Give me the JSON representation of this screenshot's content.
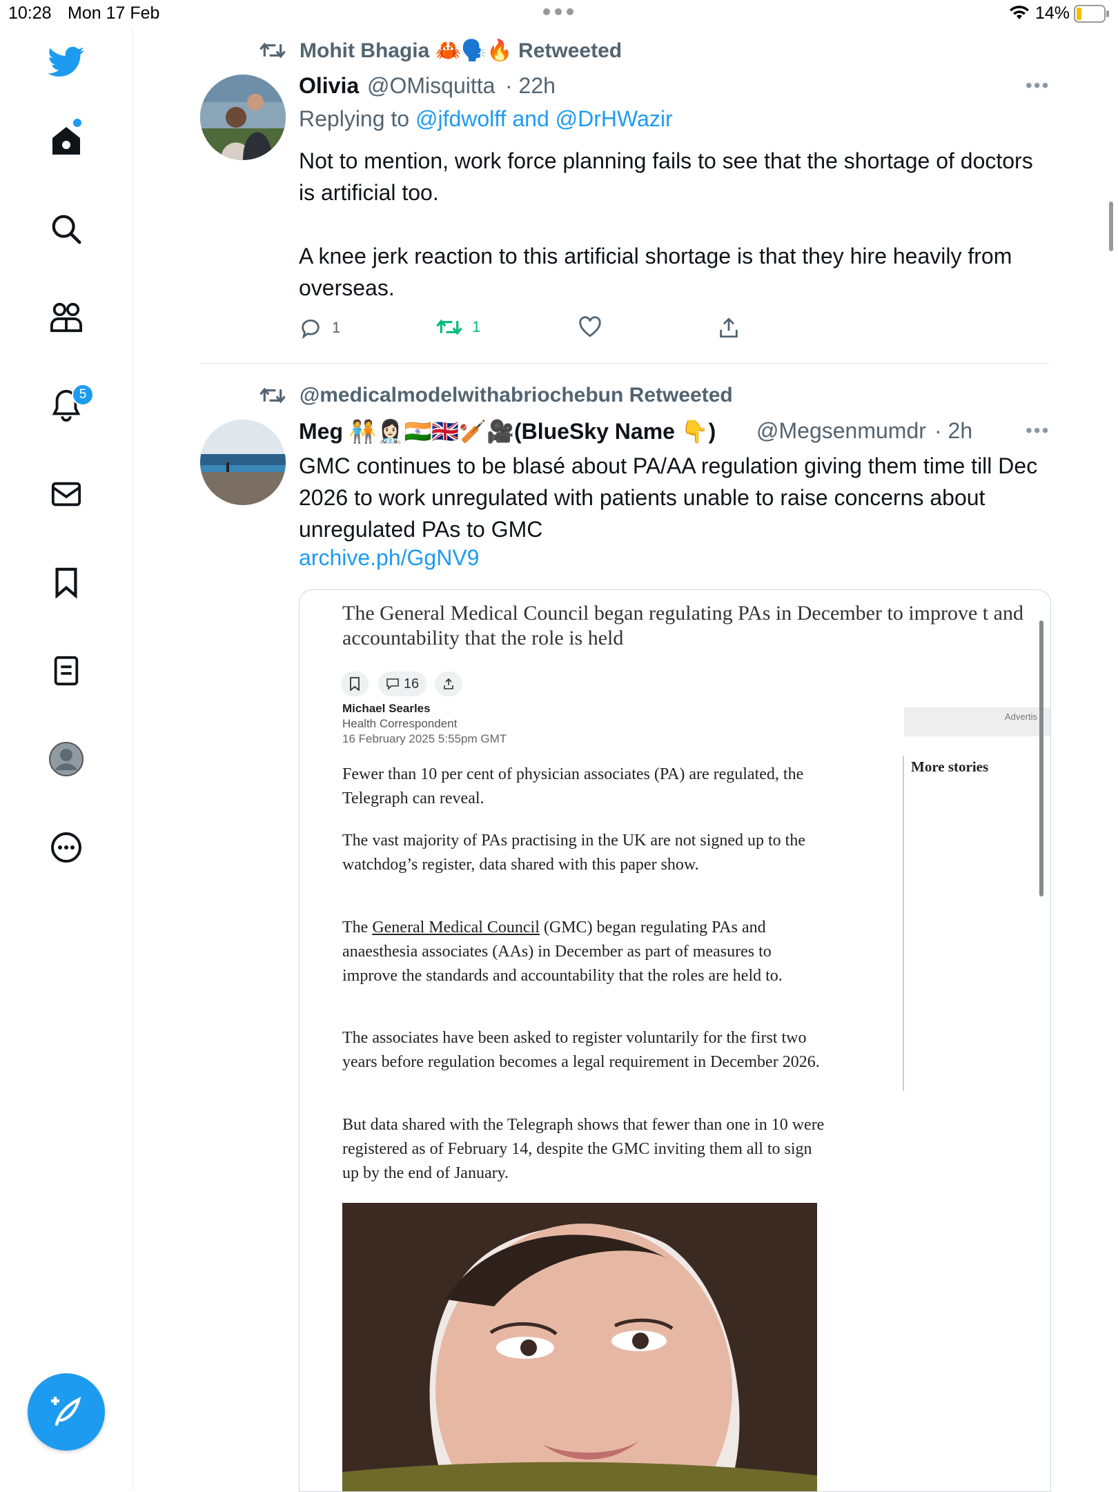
{
  "status_bar": {
    "time": "10:28",
    "date": "Mon 17 Feb",
    "battery": "14%"
  },
  "sidebar": {
    "notifications_badge": "5",
    "items": [
      "twitter-logo",
      "home",
      "explore",
      "communities",
      "notifications",
      "messages",
      "bookmarks",
      "lists",
      "profile",
      "more"
    ]
  },
  "tweets": [
    {
      "retweeted_by": "Mohit Bhagia 🦀🗣️🔥 Retweeted",
      "name": "Olivia",
      "handle": "@OMisquitta",
      "time": "· 22h",
      "replying_prefix": "Replying to ",
      "replying_to": "@jfdwolff and @DrHWazir",
      "text": "Not to mention, work force planning fails to see that the shortage of doctors is artificial too.\n\nA knee jerk reaction to this artificial shortage is that they hire heavily from overseas.",
      "replies": "1",
      "retweets": "1"
    },
    {
      "retweeted_by": "@medicalmodelwithabriochebun Retweeted",
      "name": "Meg 🧑‍🤝‍🧑👩🏻‍⚕️🇮🇳🇬🇧🏏🎥(BlueSky Name 👇)",
      "handle": "@Megsenmumdr",
      "time": "· 2h",
      "text": "GMC continues to be blasé about PA/AA regulation giving them time till Dec 2026 to work unregulated with patients unable to raise concerns about unregulated PAs to GMC",
      "link": "archive.ph/GgNV9"
    }
  ],
  "article": {
    "headline": "The General Medical Council began regulating PAs in December to improve t and accountability that the role is held",
    "comments_count": "16",
    "author": "Michael Searles",
    "author_role": "Health Correspondent",
    "date": "16 February 2025 5:55pm GMT",
    "ad_label": "Advertis",
    "more_stories": "More stories",
    "paragraphs": [
      "Fewer than 10 per cent of physician associates (PA) are regulated, the Telegraph can reveal.",
      "The vast majority of PAs practising in the UK are not signed up to the watchdog’s register, data shared with this paper show.",
      "(GMC) began regulating PAs and anaesthesia associates (AAs) in December as part of measures to improve the standards and accountability that the roles are held to.",
      "The associates have been asked to register voluntarily for the first two years before regulation becomes a legal requirement in December 2026.",
      "But data shared with the Telegraph shows that fewer than one in 10 were registered as of February 14, despite the GMC inviting them all to sign up by the end of January."
    ],
    "para3_prefix": "The ",
    "para3_link": "General Medical Council"
  },
  "colors": {
    "accent": "#1d9bf0",
    "retweet_green": "#00ba7c",
    "muted": "#536471"
  }
}
